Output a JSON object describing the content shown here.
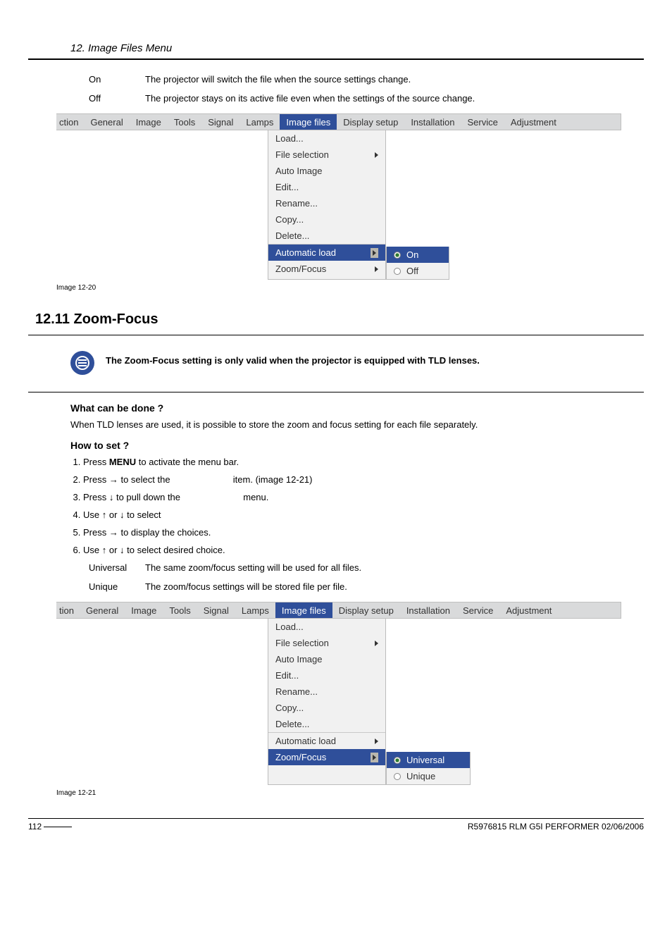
{
  "header": {
    "section": "12.  Image Files Menu"
  },
  "defs_onoff": {
    "on_key": "On",
    "on_val": "The projector will switch the file when the source settings change.",
    "off_key": "Off",
    "off_val": "The projector stays on its active file even when the settings of the source change."
  },
  "menubar": {
    "trunc_first": "ction",
    "items": [
      "General",
      "Image",
      "Tools",
      "Signal",
      "Lamps",
      "Image files",
      "Display setup",
      "Installation",
      "Service",
      "Adjustment"
    ],
    "active": "Image files"
  },
  "dropdown": {
    "items": [
      {
        "label": "Load...",
        "arrow": false
      },
      {
        "label": "File selection",
        "arrow": true
      },
      {
        "label": "Auto Image",
        "arrow": false
      },
      {
        "label": "Edit...",
        "arrow": false
      },
      {
        "label": "Rename...",
        "arrow": false
      },
      {
        "label": "Copy...",
        "arrow": false
      },
      {
        "label": "Delete...",
        "arrow": false
      },
      {
        "label": "Automatic load",
        "arrow": true,
        "sep": true
      },
      {
        "label": "Zoom/Focus",
        "arrow": true
      }
    ]
  },
  "img1220": {
    "highlight_idx": 7,
    "submenu": {
      "on": "On",
      "off": "Off",
      "selected": "On"
    },
    "caption": "Image 12-20"
  },
  "section": {
    "num_title": "12.11 Zoom-Focus",
    "note": "The Zoom-Focus setting is only valid when the projector is equipped with TLD lenses."
  },
  "what": {
    "head": "What can be done ?",
    "body": "When TLD lenses are used, it is possible to store the zoom and focus setting for each file separately."
  },
  "how": {
    "head": "How to set ?",
    "steps": [
      {
        "pre": "Press ",
        "bold": "MENU",
        "post": " to activate the menu bar."
      },
      {
        "pre": "Press → to select the ",
        "gap": true,
        "post": " item. (image 12-21)"
      },
      {
        "pre": "Press ↓ to pull down the ",
        "gap": true,
        "post": " menu."
      },
      {
        "pre": "Use ↑ or ↓ to select",
        "post": ""
      },
      {
        "pre": "Press → to display the choices.",
        "post": ""
      },
      {
        "pre": "Use ↑ or ↓ to select desired choice.",
        "post": ""
      }
    ]
  },
  "defs_univ": {
    "u_key": "Universal",
    "u_val": "The same zoom/focus setting will be used for all files.",
    "q_key": "Unique",
    "q_val": "The zoom/focus settings will be stored file per file."
  },
  "menubar2": {
    "trunc_first": "tion"
  },
  "img1221": {
    "highlight_idx": 8,
    "submenu": {
      "a": "Universal",
      "b": "Unique",
      "selected": "Universal"
    },
    "caption": "Image 12-21"
  },
  "footer": {
    "page": "112",
    "doc": "R5976815 RLM G5I PERFORMER 02/06/2006"
  }
}
